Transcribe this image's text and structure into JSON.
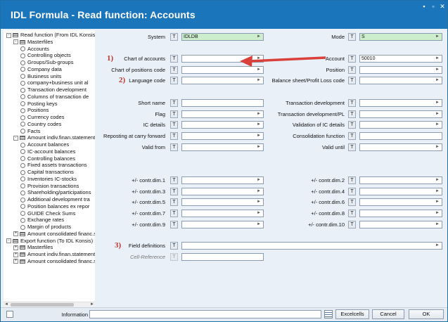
{
  "window": {
    "title": "IDL Formula - Read function: Accounts"
  },
  "tree": [
    {
      "label": "Read function (From IDL Konsis)",
      "kind": "folder",
      "exp": "-"
    },
    {
      "label": "Masterfiles",
      "kind": "folder",
      "exp": "-"
    },
    {
      "label": "Accounts",
      "kind": "leaf"
    },
    {
      "label": "Controlling objects",
      "kind": "leaf"
    },
    {
      "label": "Groups/Sub-groups",
      "kind": "leaf"
    },
    {
      "label": "Company data",
      "kind": "leaf"
    },
    {
      "label": "Business units",
      "kind": "leaf"
    },
    {
      "label": "company+business unit al",
      "kind": "leaf"
    },
    {
      "label": "Transaction development",
      "kind": "leaf"
    },
    {
      "label": "Columns of transaction de",
      "kind": "leaf"
    },
    {
      "label": "Posting keys",
      "kind": "leaf"
    },
    {
      "label": "Positions",
      "kind": "leaf"
    },
    {
      "label": "Currency codes",
      "kind": "leaf"
    },
    {
      "label": "Country codes",
      "kind": "leaf"
    },
    {
      "label": "Facts",
      "kind": "leaf"
    },
    {
      "label": "Amount indiv.finan.statements",
      "kind": "folder",
      "exp": "-"
    },
    {
      "label": "Account balances",
      "kind": "leaf"
    },
    {
      "label": "IC-account balances",
      "kind": "leaf"
    },
    {
      "label": "Controlling balances",
      "kind": "leaf"
    },
    {
      "label": "Fixed assets transactions",
      "kind": "leaf"
    },
    {
      "label": "Capital transactions",
      "kind": "leaf"
    },
    {
      "label": "Inventories IC-stocks",
      "kind": "leaf"
    },
    {
      "label": "Provision transactions",
      "kind": "leaf"
    },
    {
      "label": "Shareholding/participations",
      "kind": "leaf"
    },
    {
      "label": "Additional development tra",
      "kind": "leaf"
    },
    {
      "label": "Position balances ex repor",
      "kind": "leaf"
    },
    {
      "label": "GUIDE Check Sums",
      "kind": "leaf"
    },
    {
      "label": "Exchange rates",
      "kind": "leaf"
    },
    {
      "label": "Margin of products",
      "kind": "leaf"
    },
    {
      "label": "Amount consolidated financ.s",
      "kind": "folder",
      "exp": "+"
    },
    {
      "label": "Export function (To IDL Konsis)",
      "kind": "folder",
      "exp": "-"
    },
    {
      "label": "Masterfiles",
      "kind": "folder",
      "exp": "+"
    },
    {
      "label": "Amount indiv.finan.statements",
      "kind": "folder",
      "exp": "+"
    },
    {
      "label": "Amount consolidated financ.s",
      "kind": "folder",
      "exp": "+"
    }
  ],
  "form": {
    "t": "T",
    "arrow": "►",
    "system_label": "System",
    "system_value": "IDLDB",
    "mode_label": "Mode",
    "mode_value": "S",
    "chart_label": "Chart of accounts",
    "account_label": "Account",
    "account_value": "50010",
    "chartpos_label": "Chart of positions code",
    "position_label": "Position",
    "lang_label": "Language code",
    "bsp_label": "Balance sheet/Profit  Loss code",
    "short_label": "Short name",
    "transdev_label": "Transaction development",
    "flag_label": "Flag",
    "transdevpl_label": "Transaction development/PL",
    "ic_label": "IC details",
    "valic_label": "Validation of IC details",
    "repost_label": "Reposting at carry forward",
    "consfn_label": "Consolidation function",
    "validfrom_label": "Valid from",
    "validuntil_label": "Valid until",
    "cd1": "+/- contr.dim.1",
    "cd2": "+/- contr.dim.2",
    "cd3": "+/- contr.dim.3",
    "cd4": "+/- contr.dim.4",
    "cd5": "+/- contr.dim.5",
    "cd6": "+/- contr.dim.6",
    "cd7": "+/- contr.dim.7",
    "cd8": "+/- contr.dim.8",
    "cd9": "+/- contr.dim.9",
    "cd10": "+/- contr.dim.10",
    "fielddef_label": "Field definitions",
    "cellref_label": "Cell-Reference"
  },
  "annotations": {
    "n1": "1)",
    "n2": "2)",
    "n3": "3)",
    "arrow_color": "#d9403a"
  },
  "bottom": {
    "info_label": "Information",
    "excel_label": "Excelcells",
    "cancel_label": "Cancel",
    "ok_label": "OK"
  },
  "colors": {
    "title_bar": "#1b75bb",
    "selected_field": "#cdeecd"
  }
}
